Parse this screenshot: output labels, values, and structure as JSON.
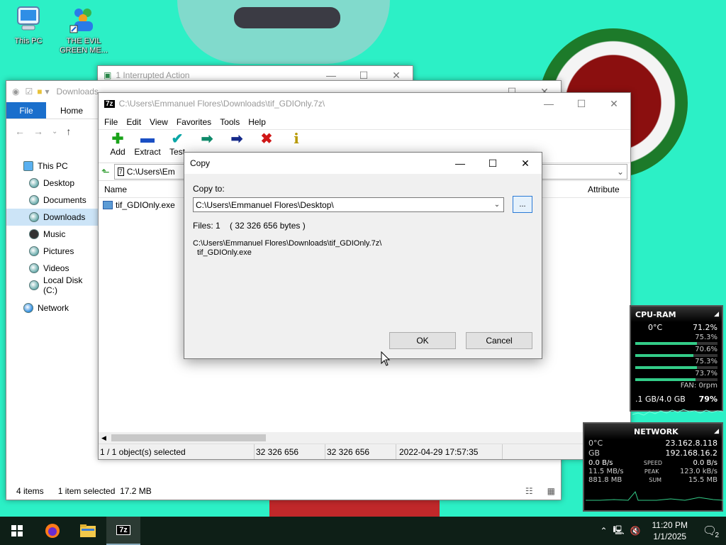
{
  "desktop": {
    "icons": [
      {
        "label": "This PC",
        "name": "this-pc-icon"
      },
      {
        "label": "THE EVIL GREEN ME...",
        "name": "evil-green-shortcut-icon"
      }
    ]
  },
  "background_window": {
    "title": "1 Interrupted Action"
  },
  "explorer": {
    "title": "Downloads",
    "ribbon": {
      "file": "File",
      "home": "Home"
    },
    "tree": [
      {
        "label": "This PC",
        "top": true
      },
      {
        "label": "Desktop"
      },
      {
        "label": "Documents"
      },
      {
        "label": "Downloads",
        "selected": true
      },
      {
        "label": "Music"
      },
      {
        "label": "Pictures"
      },
      {
        "label": "Videos"
      },
      {
        "label": "Local Disk (C:)"
      },
      {
        "label": "Network",
        "top": true
      }
    ],
    "status": {
      "items": "4 items",
      "selected": "1 item selected  17.2 MB"
    }
  },
  "sevenzip": {
    "title": "C:\\Users\\Emmanuel Flores\\Downloads\\tif_GDIOnly.7z\\",
    "menu": [
      "File",
      "Edit",
      "View",
      "Favorites",
      "Tools",
      "Help"
    ],
    "toolbar": [
      {
        "label": "Add",
        "glyph": "✚",
        "color": "#1aa31a",
        "name": "add-icon"
      },
      {
        "label": "Extract",
        "glyph": "▬",
        "color": "#1a4fc4",
        "name": "extract-icon"
      },
      {
        "label": "Test",
        "glyph": "✔",
        "color": "#0aa6a6",
        "name": "test-icon"
      },
      {
        "label": "",
        "glyph": "➡",
        "color": "#0f8a6a",
        "name": "copy-icon"
      },
      {
        "label": "",
        "glyph": "➡",
        "color": "#152a8a",
        "name": "move-icon"
      },
      {
        "label": "",
        "glyph": "✖",
        "color": "#d01818",
        "name": "delete-icon"
      },
      {
        "label": "",
        "glyph": "i",
        "color": "#b89a00",
        "name": "info-icon"
      }
    ],
    "address": "C:\\Users\\Em",
    "columns": {
      "name": "Name",
      "attributes": "Attribute"
    },
    "files": [
      {
        "name": "tif_GDIOnly.exe"
      }
    ],
    "status": {
      "selected": "1 / 1 object(s) selected",
      "size": "32 326 656",
      "packed": "32 326 656",
      "date": "2022-04-29 17:57:35"
    }
  },
  "copy_dialog": {
    "title": "Copy",
    "copy_to_label": "Copy to:",
    "destination": "C:\\Users\\Emmanuel Flores\\Desktop\\",
    "browse": "...",
    "files_info": "Files: 1    ( 32 326 656 bytes )",
    "source_path": "C:\\Users\\Emmanuel Flores\\Downloads\\tif_GDIOnly.7z\\",
    "source_file": "tif_GDIOnly.exe",
    "ok": "OK",
    "cancel": "Cancel"
  },
  "gadget_cpu": {
    "title": "CPU-RAM",
    "temp": "0°C",
    "total": "71.2%",
    "cores": [
      {
        "value": "75.3%",
        "level": 0.753
      },
      {
        "value": "70.6%",
        "level": 0.706
      },
      {
        "value": "75.3%",
        "level": 0.753
      },
      {
        "value": "73.7%",
        "level": 0.737
      }
    ],
    "fan": "FAN: 0rpm",
    "ram": ".1 GB/4.0 GB",
    "ram_pct": "79%"
  },
  "gadget_net": {
    "title": "NETWORK",
    "ip_external": "23.162.8.118",
    "ip_internal": "192.168.16.2",
    "rows": [
      {
        "left": "0.0 B/s",
        "mid": "SPEED",
        "right": "0.0 B/s"
      },
      {
        "left": "11.5 MB/s",
        "mid": "PEAK",
        "right": "123.0 kB/s"
      },
      {
        "left": "881.8 MB",
        "mid": "SUM",
        "right": "15.5 MB"
      }
    ],
    "left_labels": {
      "temp": "0°C",
      "gb": "GB"
    }
  },
  "taskbar": {
    "time": "11:20 PM",
    "date": "1/1/2025",
    "notifications": "2"
  },
  "colors": {
    "desktop": "#2cf0c6",
    "taskbar": "#0e1f17",
    "ribbon_file": "#1a6fcc"
  }
}
